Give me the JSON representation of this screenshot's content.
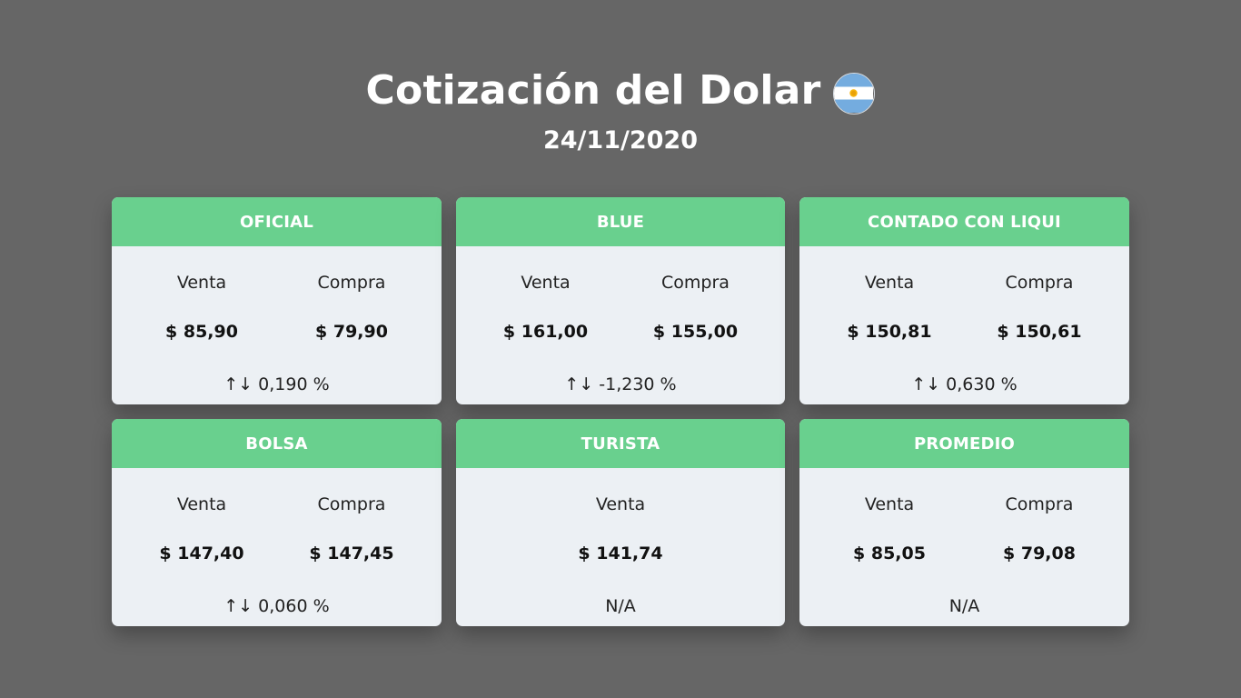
{
  "header": {
    "title": "Cotización del Dolar",
    "date": "24/11/2020",
    "flag_icon": "argentina-flag-icon"
  },
  "colors": {
    "background": "#666666",
    "card_header": "#69d08e",
    "card_body": "#ecf0f4"
  },
  "labels": {
    "venta": "Venta",
    "compra": "Compra",
    "variation_icon": "↑↓"
  },
  "cards": [
    {
      "title": "OFICIAL",
      "venta": "$ 85,90",
      "compra": "$ 79,90",
      "variation": "0,190 %"
    },
    {
      "title": "BLUE",
      "venta": "$ 161,00",
      "compra": "$ 155,00",
      "variation": "-1,230 %"
    },
    {
      "title": "CONTADO CON LIQUI",
      "venta": "$ 150,81",
      "compra": "$ 150,61",
      "variation": "0,630 %"
    },
    {
      "title": "BOLSA",
      "venta": "$ 147,40",
      "compra": "$ 147,45",
      "variation": "0,060 %"
    },
    {
      "title": "TURISTA",
      "venta": "$ 141,74",
      "variation": "N/A"
    },
    {
      "title": "PROMEDIO",
      "venta": "$ 85,05",
      "compra": "$ 79,08",
      "variation": "N/A"
    }
  ]
}
